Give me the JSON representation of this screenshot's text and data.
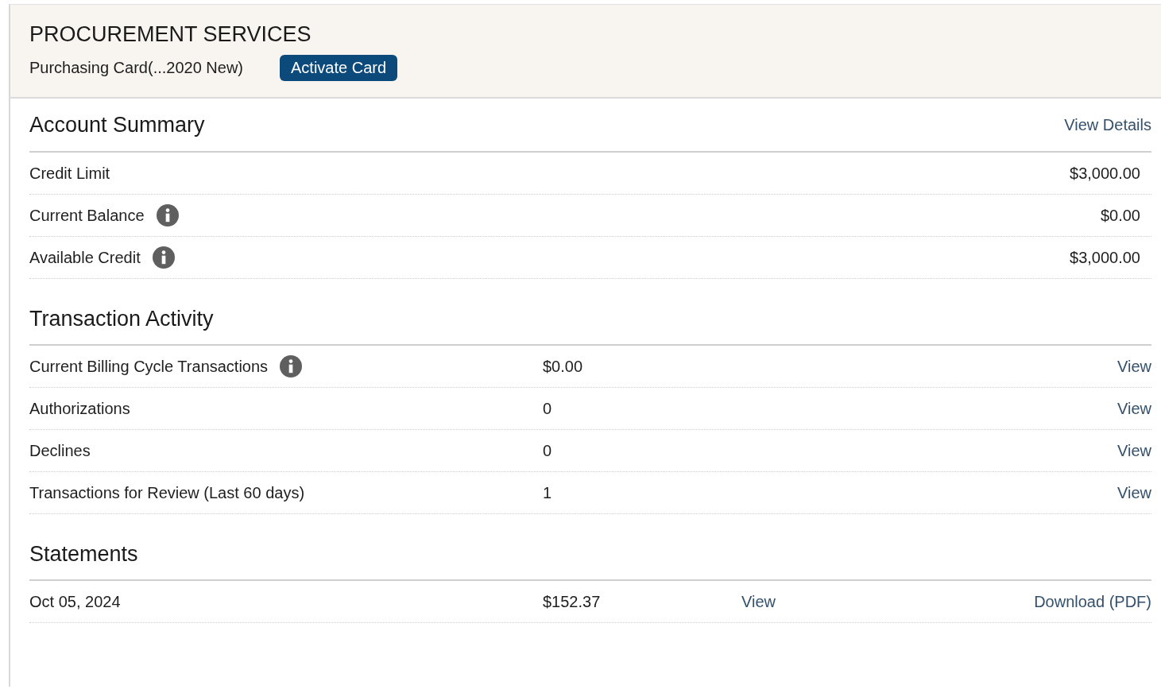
{
  "header": {
    "title": "PROCUREMENT SERVICES",
    "card_label": "Purchasing Card(...2020 New)",
    "activate_button": "Activate Card"
  },
  "account_summary": {
    "title": "Account Summary",
    "link": "View Details",
    "rows": [
      {
        "label": "Credit Limit",
        "info": false,
        "value": "$3,000.00"
      },
      {
        "label": "Current Balance",
        "info": true,
        "value": "$0.00"
      },
      {
        "label": "Available Credit",
        "info": true,
        "value": "$3,000.00"
      }
    ]
  },
  "transaction_activity": {
    "title": "Transaction Activity",
    "rows": [
      {
        "label": "Current Billing Cycle Transactions",
        "info": true,
        "value": "$0.00",
        "link": "View"
      },
      {
        "label": "Authorizations",
        "info": false,
        "value": "0",
        "link": "View"
      },
      {
        "label": "Declines",
        "info": false,
        "value": "0",
        "link": "View"
      },
      {
        "label": "Transactions for Review (Last 60 days)",
        "info": false,
        "value": "1",
        "link": "View"
      }
    ]
  },
  "statements": {
    "title": "Statements",
    "rows": [
      {
        "date": "Oct 05, 2024",
        "amount": "$152.37",
        "view": "View",
        "download": "Download (PDF)"
      }
    ]
  }
}
